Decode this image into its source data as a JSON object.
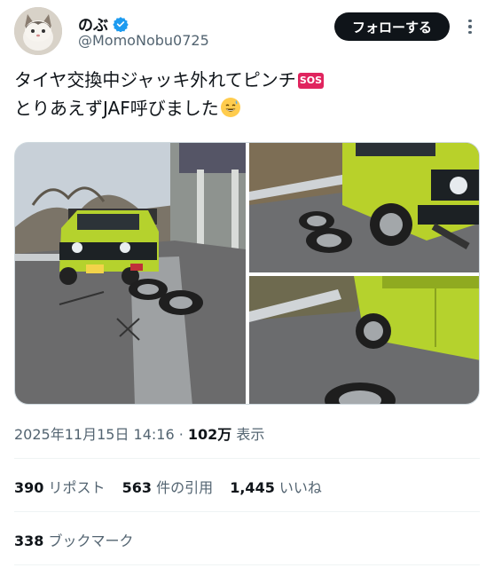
{
  "author": {
    "display_name": "のぶ",
    "handle": "@MomoNobu0725",
    "avatar": "cat-avatar",
    "verified_icon": "verified-badge-icon"
  },
  "header": {
    "follow_label": "フォローする",
    "more_icon": "more-icon"
  },
  "tweet": {
    "line1": "タイヤ交換中ジャッキ外れてピンチ",
    "line1_emoji": "SOS",
    "line2": "とりあえずJAF呼びました",
    "line2_emoji": "grinning-sweat-emoji"
  },
  "media": {
    "photos": [
      {
        "alt": "photo-1"
      },
      {
        "alt": "photo-2"
      },
      {
        "alt": "photo-3"
      }
    ]
  },
  "meta": {
    "date": "2025年11月15日 14:16",
    "separator": " · ",
    "views_count": "102万",
    "views_label": " 表示"
  },
  "stats": {
    "reposts_count": "390",
    "reposts_label": "リポスト",
    "quotes_count": "563",
    "quotes_label": "件の引用",
    "likes_count": "1,445",
    "likes_label": "いいね",
    "bookmarks_count": "338",
    "bookmarks_label": "ブックマーク"
  },
  "colors": {
    "accent_verified": "#1d9bf0",
    "button_bg": "#0f1419",
    "muted_text": "#536471",
    "car_green": "#b5d22d"
  }
}
